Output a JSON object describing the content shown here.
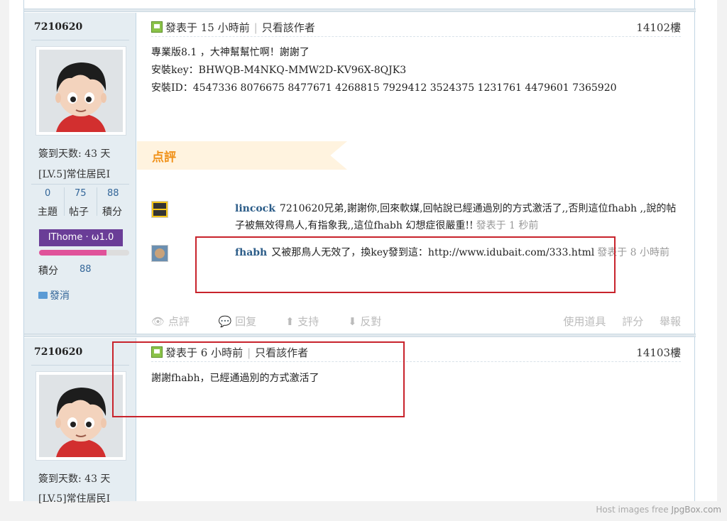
{
  "post1": {
    "username": "7210620",
    "posted": "發表于 15 小時前",
    "author_only": "只看該作者",
    "floor": "14102樓",
    "lines": [
      "專業版8.1 ，大神幫幫忙啊！謝謝了",
      "安裝key：BHWQB-M4NKQ-MMW2D-KV96X-8QJK3",
      "安裝ID：4547336 8076675 8477671 4268815 7929412 3524375 1231761 4479601 7365920"
    ],
    "signin": "簽到天数: 43 天",
    "level": "[LV.5]常住居民I",
    "stats": {
      "topics": "0",
      "posts": "75",
      "points": "88",
      "topics_label": "主題",
      "posts_label": "帖子",
      "points_label": "積分"
    },
    "badge": "IThome · ω1.0",
    "badge_progress": 0.75,
    "points_label": "積分",
    "points_value": "88",
    "message_label": "發消"
  },
  "rating": {
    "title": "点評",
    "comments": [
      {
        "user": "lincock",
        "text": "7210620兄弟,謝謝你,回來軟媒,回帖說已經通過別的方式激活了,,否則這位fhabh ,,說的帖子被無效得鳥人,有指象我,,這位fhabh 幻想症很嚴重!!",
        "time": "發表于 1 秒前"
      },
      {
        "user": "fhabh",
        "text": "又被那鳥人无效了，換key發到這：http://www.idubait.com/333.html",
        "time": "發表于 8 小時前"
      }
    ]
  },
  "actions": {
    "comment": "点評",
    "reply": "回复",
    "support": "支持",
    "oppose": "反對",
    "tools": "使用道具",
    "rate": "評分",
    "report": "舉報"
  },
  "post2": {
    "username": "7210620",
    "posted": "發表于 6 小時前",
    "author_only": "只看該作者",
    "floor": "14103樓",
    "text": "謝謝fhabh，已經通過別的方式激活了",
    "signin": "簽到天数: 43 天",
    "level": "[LV.5]常住居民I"
  },
  "footer": {
    "host_prefix": "Host images free",
    "host_brand": "JpgBox.com"
  },
  "colors": {
    "highlight_box": "#c8232c",
    "badge": "#6a3d97",
    "accent_orange": "#f0921b",
    "link_blue": "#2b5c88"
  }
}
